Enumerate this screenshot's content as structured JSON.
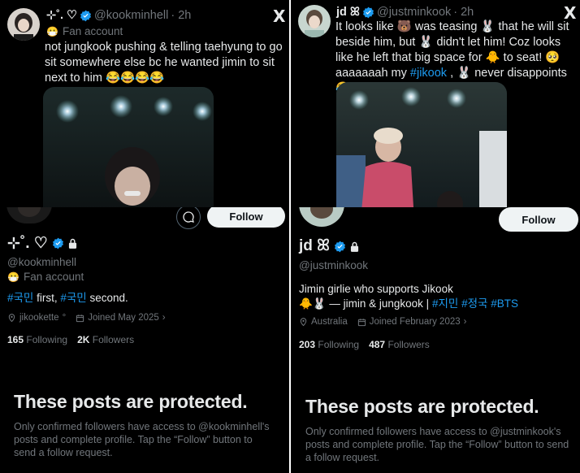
{
  "top_left": {
    "name": "⊹˚. ♡",
    "handle": "@kookminhell",
    "time": "· 2h",
    "label": "Fan account",
    "label_icon": "😷",
    "text": "not jungkook pushing & telling taehyung to go sit somewhere else bc he wanted jimin to sit next to him 😂😂😂😂"
  },
  "top_right": {
    "name": "jd ꕤ",
    "handle": "@justminkook",
    "time": "· 2h",
    "text_parts": [
      "It looks like 🐻 was teasing 🐰 that he will sit beside him, but 🐰 didn't let him! Coz looks like he left that big space for 🐥 to seat! 🥺 aaaaaaah my ",
      "#jikook",
      " , 🐰 never disappoints 😂"
    ]
  },
  "bottom_left": {
    "name": "⊹˚. ♡",
    "handle": "@kookminhell",
    "label": "Fan account",
    "label_icon": "😷",
    "bio": [
      {
        "t": "#국민",
        "tag": true
      },
      {
        "t": " first, ",
        "tag": false
      },
      {
        "t": "#국민",
        "tag": true
      },
      {
        "t": " second.",
        "tag": false
      }
    ],
    "location": "jikookette",
    "location_suffix": "°",
    "joined": "Joined May 2025",
    "following": "165",
    "following_label": "Following",
    "followers": "2K",
    "followers_label": "Followers",
    "follow_label": "Follow",
    "protected_title": "These posts are protected.",
    "protected_body": "Only confirmed followers have access to @kookminhell's posts and complete profile. Tap the “Follow” button to send a follow request."
  },
  "bottom_right": {
    "name": "jd ꕤ",
    "handle": "@justminkook",
    "bio_line1": "Jimin girlie who supports Jikook",
    "bio_line2_prefix": "🐥🐰 — jimin & jungkook | ",
    "bio_tags": [
      "#지민",
      "#정국",
      "#BTS"
    ],
    "location": "Australia",
    "joined": "Joined February 2023",
    "following": "203",
    "following_label": "Following",
    "followers": "487",
    "followers_label": "Followers",
    "follow_label": "Follow",
    "protected_title": "These posts are protected.",
    "protected_body": "Only confirmed followers have access to @justminkook's posts and complete profile. Tap the “Follow” button to send a follow request."
  },
  "icons": {
    "x_logo": "X",
    "chevron": "›"
  },
  "colors": {
    "background": "#000000",
    "text": "#e7e9ea",
    "muted": "#71767b",
    "link": "#1d9bf0",
    "button_bg": "#eff3f4",
    "button_text": "#0f1419"
  }
}
